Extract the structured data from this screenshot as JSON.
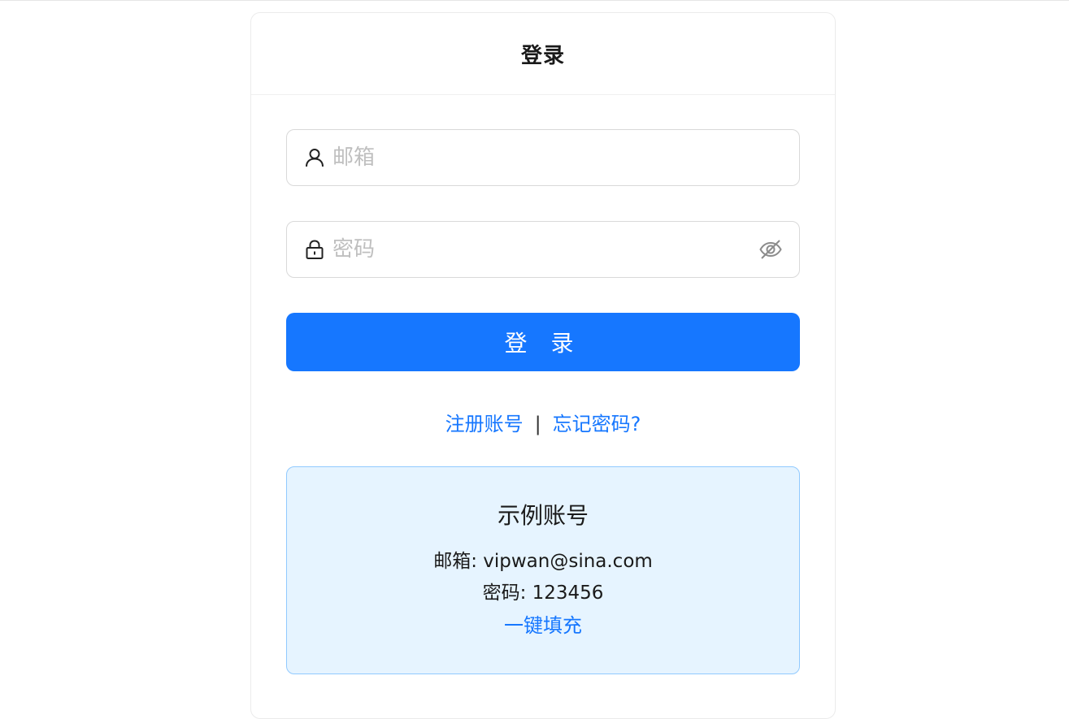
{
  "card": {
    "title": "登录"
  },
  "form": {
    "email": {
      "placeholder": "邮箱",
      "value": ""
    },
    "password": {
      "placeholder": "密码",
      "value": ""
    },
    "submit_label": "登 录"
  },
  "links": {
    "register": "注册账号",
    "separator": "|",
    "forgot": "忘记密码?"
  },
  "demo": {
    "title": "示例账号",
    "email_line": "邮箱: vipwan@sina.com",
    "password_line": "密码: 123456",
    "fill_label": "一键填充"
  },
  "icons": {
    "email_field": "user-icon",
    "password_field": "lock-icon",
    "toggle": "eye-invisible-icon"
  },
  "colors": {
    "primary": "#1677ff",
    "demo_bg": "#e6f4ff",
    "demo_border": "#91caff",
    "placeholder": "#bfbfbf"
  }
}
